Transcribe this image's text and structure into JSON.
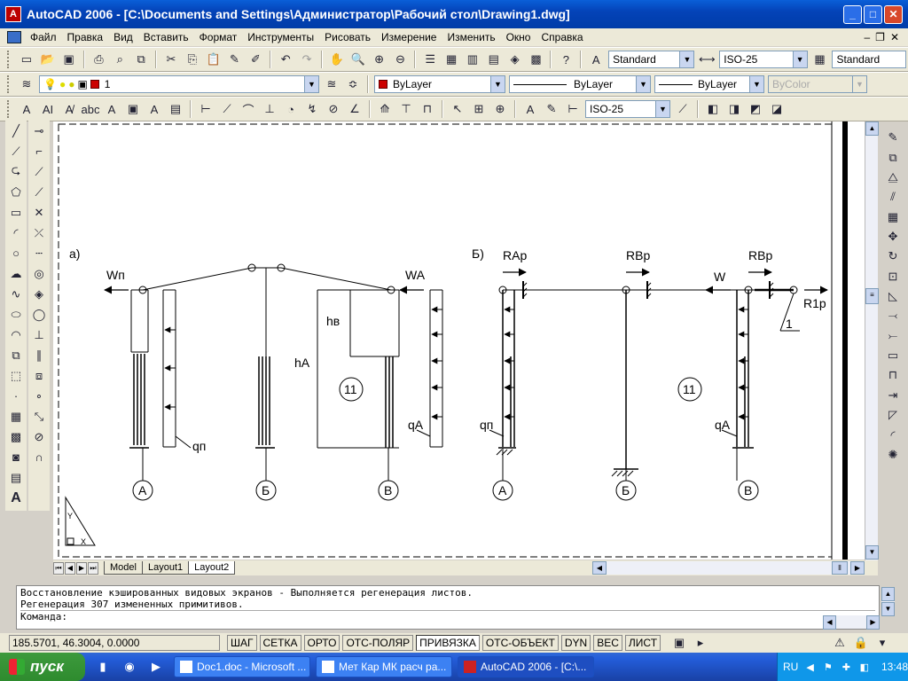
{
  "window": {
    "title": "AutoCAD 2006 - [C:\\Documents and Settings\\Администратор\\Рабочий стол\\Drawing1.dwg]"
  },
  "menu": [
    "Файл",
    "Правка",
    "Вид",
    "Вставить",
    "Формат",
    "Инструменты",
    "Рисовать",
    "Измерение",
    "Изменить",
    "Окно",
    "Справка"
  ],
  "toolbar": {
    "text_style": "Standard",
    "dim_style": "ISO-25",
    "table_style": "Standard",
    "layer": "1",
    "color": "ByLayer",
    "linetype": "ByLayer",
    "lineweight": "ByLayer",
    "plotstyle": "ByColor",
    "dim_style2": "ISO-25"
  },
  "drawing": {
    "labels": {
      "a": "а)",
      "b": "Б)",
      "wp": "Wп",
      "wa": "WA",
      "w": "W",
      "hb": "hв",
      "ha": "hA",
      "qp_left": "qп",
      "qa_left": "qA",
      "qp_right": "qп",
      "qa_right": "qA",
      "rap": "RAp",
      "rbp1": "RBp",
      "rbp2": "RBp",
      "r1p": "R1p",
      "one": "1",
      "eleven_left": "11",
      "eleven_right": "11",
      "axis_a1": "А",
      "axis_b1": "Б",
      "axis_v1": "В",
      "axis_a2": "А",
      "axis_b2": "Б",
      "axis_v2": "В",
      "ucs_y": "Y",
      "ucs_x": "X"
    }
  },
  "tabs": [
    "Model",
    "Layout1",
    "Layout2"
  ],
  "command": {
    "lines": [
      "Восстановление кэшированных видовых экранов - Выполняется регенерация листов.",
      "Регенерация 307 измененных примитивов."
    ],
    "prompt": "Команда:"
  },
  "status": {
    "coords": "185.5701, 46.3004, 0.0000",
    "toggles": [
      "ШАГ",
      "СЕТКА",
      "ОРТО",
      "ОТС-ПОЛЯР",
      "ПРИВЯЗКА",
      "ОТС-ОБЪЕКТ",
      "DYN",
      "ВЕС",
      "ЛИСТ"
    ]
  },
  "taskbar": {
    "start": "пуск",
    "tasks": [
      "Doc1.doc - Microsoft ...",
      "Мет Кар МК расч ра...",
      "AutoCAD 2006 - [C:\\..."
    ],
    "lang": "RU",
    "clock": "13:48"
  }
}
